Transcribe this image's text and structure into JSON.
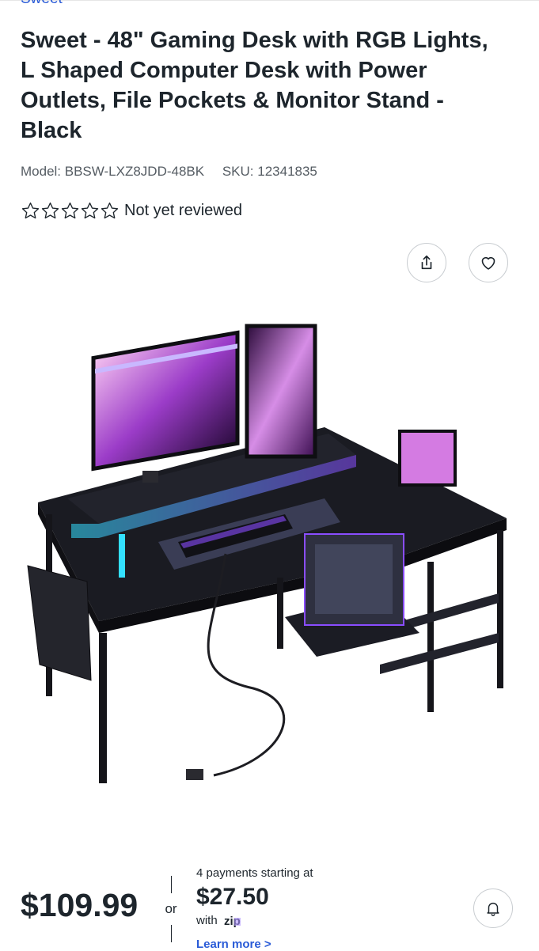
{
  "brand": {
    "link_label": "Sweet"
  },
  "product": {
    "title": "Sweet - 48\" Gaming Desk with RGB Lights, L Shaped Computer Desk with Power Outlets, File Pockets & Monitor Stand - Black",
    "model_label": "Model: BBSW-LXZ8JDD-48BK",
    "sku_label": "SKU: 12341835",
    "rating": {
      "stars": 0,
      "max_stars": 5,
      "text": "Not yet reviewed"
    }
  },
  "actions": {
    "share_icon": "share-icon",
    "favorite_icon": "heart-icon",
    "notify_icon": "bell-icon"
  },
  "pricing": {
    "price": "$109.99",
    "or_text": "or",
    "payments_label": "4 payments starting at",
    "installment": "$27.50",
    "with_text": "with",
    "provider": "zip",
    "learn_more": "Learn more >"
  },
  "colors": {
    "text": "#1d252c",
    "link": "#2a5bd7",
    "muted": "#555c63",
    "rgb_purple": "#8a4dff",
    "rgb_cyan": "#33e0ff"
  }
}
